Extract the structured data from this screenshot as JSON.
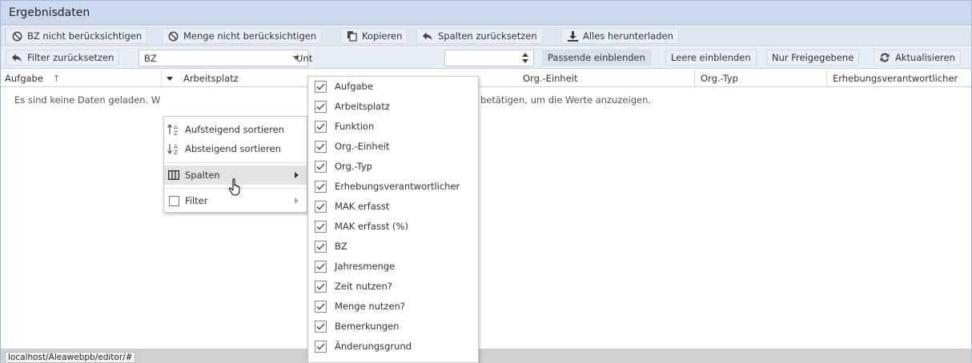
{
  "panel": {
    "title": "Ergebnisdaten"
  },
  "toolbar1": {
    "buttons": [
      {
        "label": "BZ nicht berücksichtigen",
        "icon": "ban-icon"
      },
      {
        "label": "Menge nicht berücksichtigen",
        "icon": "ban-icon"
      },
      {
        "label": "Kopieren",
        "icon": "copy-icon"
      },
      {
        "label": "Spalten zurücksetzen",
        "icon": "undo-icon"
      },
      {
        "label": "Alles herunterladen",
        "icon": "download-icon"
      }
    ]
  },
  "toolbar2": {
    "reset_filter_label": "Filter zurücksetzen",
    "bz_select_value": "BZ",
    "unt_label_partial": "Unt",
    "show_matching_label": "Passende einblenden",
    "show_empty_label": "Leere einblenden",
    "only_released_label": "Nur Freigegebene",
    "refresh_label": "Aktualisieren"
  },
  "grid": {
    "columns": [
      "Aufgabe",
      "Arbeitsplatz",
      "Org.-Einheit",
      "Org.-Typ",
      "Erhebungsverantwortlicher"
    ],
    "sort_indicator": "↑",
    "empty_message_left": "Es sind keine Daten geladen. W",
    "empty_message_right": "betätigen, um die Werte anzuzeigen."
  },
  "context_menu": {
    "sort_asc": "Aufsteigend sortieren",
    "sort_desc": "Absteigend sortieren",
    "columns": "Spalten",
    "filter": "Filter"
  },
  "columns_submenu": [
    {
      "label": "Aufgabe",
      "checked": true
    },
    {
      "label": "Arbeitsplatz",
      "checked": true
    },
    {
      "label": "Funktion",
      "checked": true
    },
    {
      "label": "Org.-Einheit",
      "checked": true
    },
    {
      "label": "Org.-Typ",
      "checked": true
    },
    {
      "label": "Erhebungsverantwortlicher",
      "checked": true
    },
    {
      "label": "MAK erfasst",
      "checked": true
    },
    {
      "label": "MAK erfasst (%)",
      "checked": true
    },
    {
      "label": "BZ",
      "checked": true
    },
    {
      "label": "Jahresmenge",
      "checked": true
    },
    {
      "label": "Zeit nutzen?",
      "checked": true
    },
    {
      "label": "Menge nutzen?",
      "checked": true
    },
    {
      "label": "Bemerkungen",
      "checked": true
    },
    {
      "label": "Änderungsgrund",
      "checked": true
    }
  ],
  "status_url": "localhost/Aleawebpb/editor/#",
  "colors": {
    "header_bg": "#cbd9ec",
    "toolbar_bg": "#dde6f2",
    "check_color": "#5a5a5a"
  }
}
